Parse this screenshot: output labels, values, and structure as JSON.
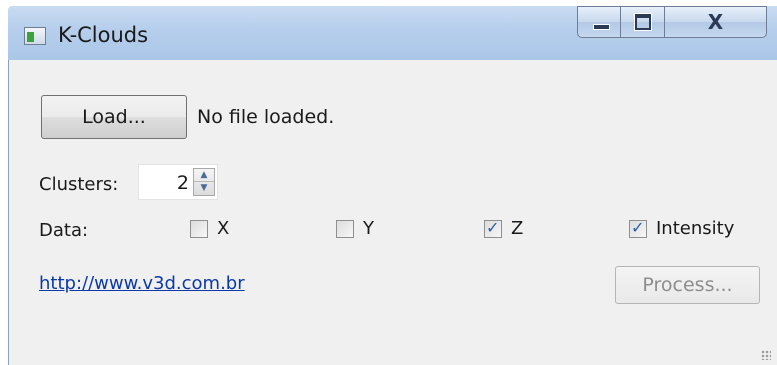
{
  "window": {
    "title": "K-Clouds",
    "icon": "app-icon",
    "caption_buttons": {
      "minimize_icon": "minimize-icon",
      "maximize_icon": "maximize-icon",
      "close_label": "X"
    }
  },
  "file": {
    "load_label": "Load...",
    "status": "No file loaded."
  },
  "clusters": {
    "label": "Clusters:",
    "value": "2"
  },
  "data_options": {
    "label": "Data:",
    "items": [
      {
        "label": "X",
        "checked": false
      },
      {
        "label": "Y",
        "checked": false
      },
      {
        "label": "Z",
        "checked": true
      },
      {
        "label": "Intensity",
        "checked": true
      }
    ]
  },
  "footer": {
    "link_text": "http://www.v3d.com.br",
    "process_label": "Process...",
    "process_enabled": false
  },
  "colors": {
    "titlebar": "#b7cfec",
    "client_bg": "#f0f0f0",
    "link": "#0b3aa8",
    "checkmark": "#2b5ea7",
    "disabled_text": "#8d8d8d"
  }
}
